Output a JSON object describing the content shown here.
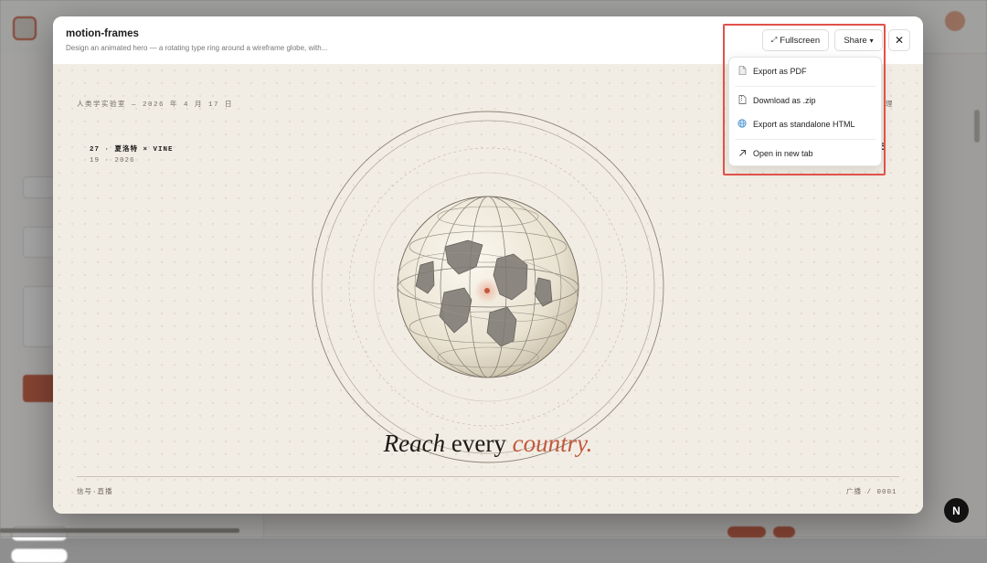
{
  "modal": {
    "title": "motion-frames",
    "subtitle": "Design an animated hero — a rotating type ring around a wireframe globe, with...",
    "fullscreen_label": "Fullscreen",
    "share_label": "Share",
    "close_glyph": "✕",
    "fullscreen_glyph": "⤢",
    "share_glyph": "▾"
  },
  "preview": {
    "date_line": "人类学实验室 — 2026 年 4 月 17 日",
    "right_fragment": "理",
    "right_fragment_2": "5",
    "publication_line_1": "27 · 夏洛特 × VINE",
    "publication_line_2": "19 · 2026",
    "headline_part_1": "Reach",
    "headline_part_2": "every",
    "headline_part_3": "country.",
    "footer_left": "信号·直播",
    "footer_right": "广播 / 0001",
    "accent_color": "#c2583d"
  },
  "share_menu": {
    "items": [
      {
        "label": "Export as PDF",
        "icon": "file-icon"
      },
      {
        "label": "Download as .zip",
        "icon": "zip-icon"
      },
      {
        "label": "Export as standalone HTML",
        "icon": "globe-icon"
      },
      {
        "label": "Open in new tab",
        "icon": "arrow-up-right-icon"
      }
    ]
  },
  "badge": {
    "letter": "N"
  }
}
